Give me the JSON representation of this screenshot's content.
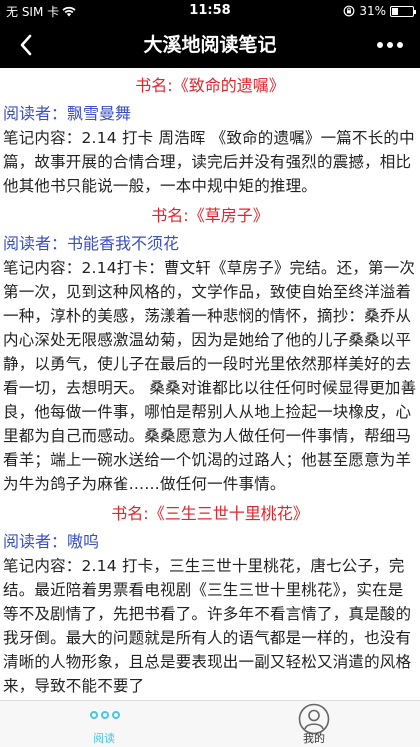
{
  "status": {
    "carrier": "无 SIM 卡",
    "time": "11:58",
    "battery": "31%",
    "battery_level": 0.31
  },
  "nav": {
    "title": "大溪地阅读笔记"
  },
  "entries": [
    {
      "book": "书名:《致命的遗嘱》",
      "reader": "阅读者：飘雪曼舞",
      "note": "笔记内容：2.14 打卡 周浩晖 《致命的遗嘱》一篇不长的中篇，故事开展的合情合理，读完后并没有强烈的震撼，相比他其他书只能说一般，一本中规中矩的推理。"
    },
    {
      "book": "书名:《草房子》",
      "reader": "阅读者：书能香我不须花",
      "note": "笔记内容：2.14打卡：曹文轩《草房子》完结。还，第一次第一次，见到这种风格的，文学作品，致使自始至终洋溢着一种，淳朴的美感，荡漾着一种悲悯的情怀，摘抄：桑乔从内心深处无限感激温幼菊，因为是她给了他的儿子桑桑以平静，以勇气，使儿子在最后的一段时光里依然那样美好的去看一切，去想明天。 桑桑对谁都比以往任何时候显得更加善良，他每做一件事，哪怕是帮别人从地上捡起一块橡皮，心里都为自己而感动。桑桑愿意为人做任何一件事情，帮细马看羊；端上一碗水送给一个饥渴的过路人；他甚至愿意为羊为牛为鸽子为麻雀……做任何一件事情。"
    },
    {
      "book": "书名:《三生三世十里桃花》",
      "reader": "阅读者：嗷呜",
      "note": "笔记内容：2.14 打卡，三生三世十里桃花，唐七公子，完结。最近陪着男票看电视剧《三生三世十里桃花》，实在是等不及剧情了，先把书看了。许多年不看言情了，真是酸的我牙倒。最大的问题就是所有人的语气都是一样的，也没有清晰的人物形象，且总是要表现出一副又轻松又消遣的风格来，导致不能不要了"
    }
  ],
  "tabs": {
    "read": "阅读",
    "mine": "我的"
  },
  "colors": {
    "book_title": "#e0262d",
    "reader": "#3a4fc2",
    "tab_active": "#49c5e6"
  }
}
